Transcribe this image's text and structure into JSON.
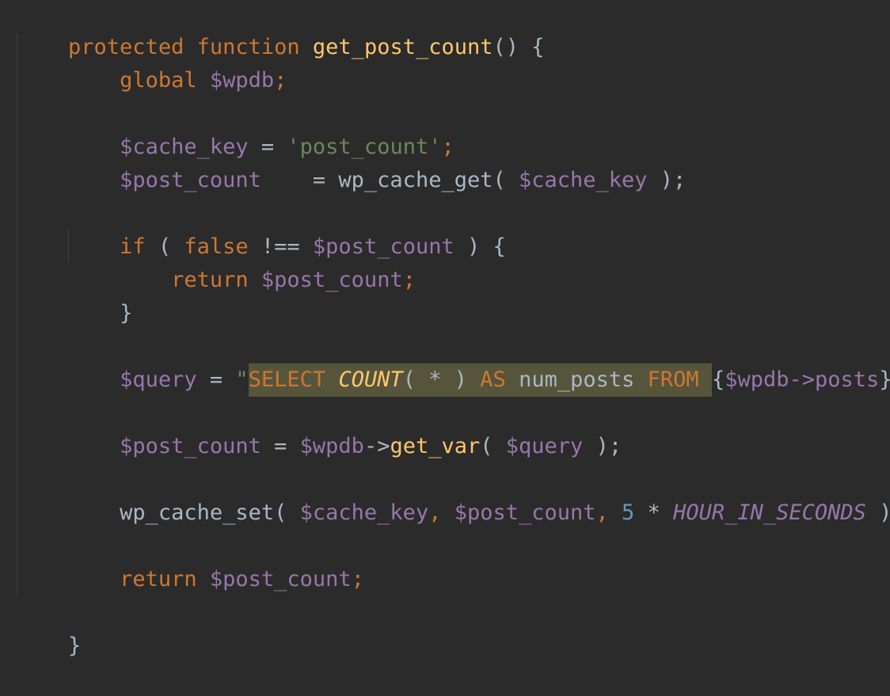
{
  "code": {
    "l1": {
      "kw_protected": "protected",
      "kw_function": "function",
      "fn_name": "get_post_count",
      "rest": "() {"
    },
    "l2": {
      "kw_global": "global",
      "var": "$wpdb",
      "semi": ";"
    },
    "l4": {
      "var": "$cache_key",
      "eq": " = ",
      "str": "'post_count'",
      "semi": ";"
    },
    "l5": {
      "var": "$post_count",
      "mid": "    = wp_cache_get( ",
      "arg": "$cache_key",
      "end": " );"
    },
    "l7": {
      "kw_if": "if",
      "p1": " ( ",
      "kw_false": "false",
      "op": " !== ",
      "var": "$post_count",
      "end": " ) {"
    },
    "l8": {
      "kw_return": "return",
      "var": "$post_count",
      "semi": ";"
    },
    "l9": {
      "brace": "}"
    },
    "l11": {
      "var": "$query",
      "eq": " = ",
      "q_open": "\"",
      "select": "SELECT",
      "count": "COUNT",
      "paren_star": "( * )",
      "as": "AS",
      "num_posts": "num_posts",
      "from": "FROM",
      "brace_open": "{",
      "wpdb_posts": "$wpdb->posts",
      "brace_close": "}",
      "q_close": "\"",
      "semi": ";"
    },
    "l13": {
      "var": "$post_count",
      "eq": " = ",
      "obj": "$wpdb",
      "arrow": "->",
      "method": "get_var",
      "p_open": "( ",
      "arg": "$query",
      "end": " );"
    },
    "l15": {
      "fn": "wp_cache_set( ",
      "arg1": "$cache_key",
      "comma1": ", ",
      "arg2": "$post_count",
      "comma2": ", ",
      "num": "5",
      "star": " * ",
      "const": "HOUR_IN_SECONDS",
      "end": " );"
    },
    "l17": {
      "kw_return": "return",
      "var": "$post_count",
      "semi": ";"
    },
    "l19": {
      "brace": "}"
    }
  }
}
